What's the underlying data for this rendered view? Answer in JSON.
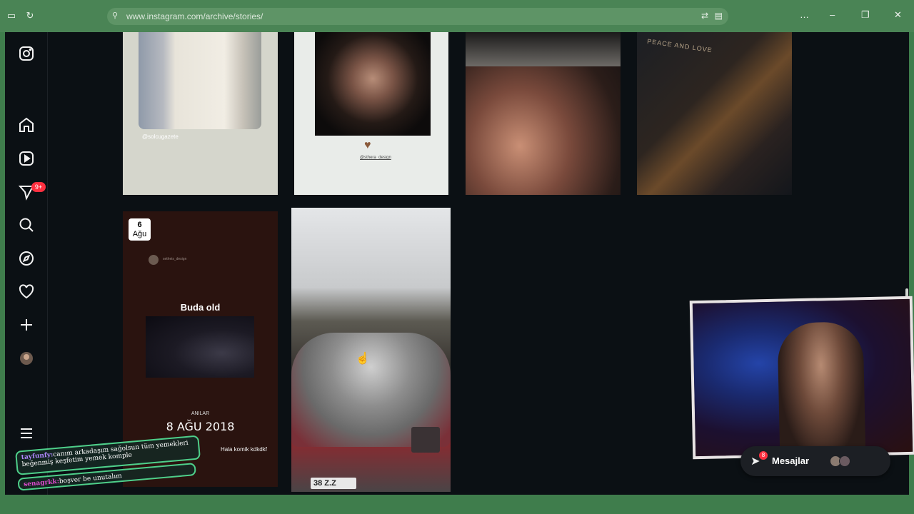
{
  "browser": {
    "url": "www.instagram.com/archive/stories/",
    "window_controls": [
      "…",
      "–",
      "❐",
      "✕"
    ]
  },
  "sidebar": {
    "items": [
      {
        "icon": "instagram-logo-icon"
      },
      {
        "icon": "home-icon"
      },
      {
        "icon": "reels-icon"
      },
      {
        "icon": "messages-icon",
        "badge": "9+"
      },
      {
        "icon": "search-icon"
      },
      {
        "icon": "explore-icon"
      },
      {
        "icon": "heart-icon"
      },
      {
        "icon": "create-icon"
      },
      {
        "icon": "profile-avatar"
      },
      {
        "icon": "menu-icon"
      }
    ]
  },
  "archive": {
    "tile1": {
      "credit": "@solcugazete"
    },
    "tile2": {
      "credit": "@sthera_design"
    },
    "tile4": {
      "sign": "PEACE AND LOVE"
    },
    "tile5": {
      "date_day": "6",
      "date_month": "Ağu",
      "username": "setheis_design",
      "title": "Buda old",
      "memories_label": "ANILAR",
      "memories_date": "8 AĞU 2018",
      "caption": "Hala komik kdkdkf"
    },
    "tile6": {
      "plate": "38 Z.Z"
    }
  },
  "messages": {
    "label": "Mesajlar",
    "badge": "8"
  },
  "chat": [
    {
      "user": "tayfunfy:",
      "text": "canım arkadaşım sağolsun tüm yemekleri beğenmiş keşfetim yemek komple"
    },
    {
      "user": "senagrkk:",
      "text": "boşver be unutalım"
    }
  ]
}
